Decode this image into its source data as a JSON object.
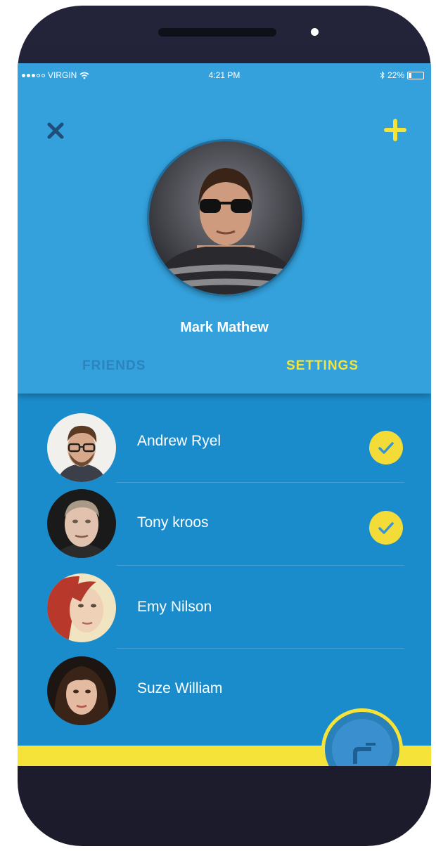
{
  "status_bar": {
    "carrier": "VIRGIN",
    "time": "4:21 PM",
    "battery": "22%",
    "battery_level": 0.22
  },
  "profile": {
    "name": "Mark Mathew"
  },
  "tabs": [
    {
      "label": "FRIENDS",
      "active": false
    },
    {
      "label": "SETTINGS",
      "active": true
    }
  ],
  "contacts": [
    {
      "name": "Andrew Ryel",
      "checked": true
    },
    {
      "name": "Tony kroos",
      "checked": true
    },
    {
      "name": "Emy Nilson",
      "checked": false
    },
    {
      "name": "Suze William",
      "checked": false
    }
  ],
  "icons": {
    "close": "close-icon",
    "add": "plus-icon",
    "check": "check-icon",
    "fab": "faucet-icon",
    "wifi": "wifi-icon",
    "battery": "battery-icon",
    "bluetooth": "bluetooth-icon"
  },
  "colors": {
    "header": "#34a1dc",
    "list_bg": "#1b8ccb",
    "accent_yellow": "#f5e33a",
    "inactive_tab": "#2b84bc",
    "frame": "#1f1f33"
  }
}
